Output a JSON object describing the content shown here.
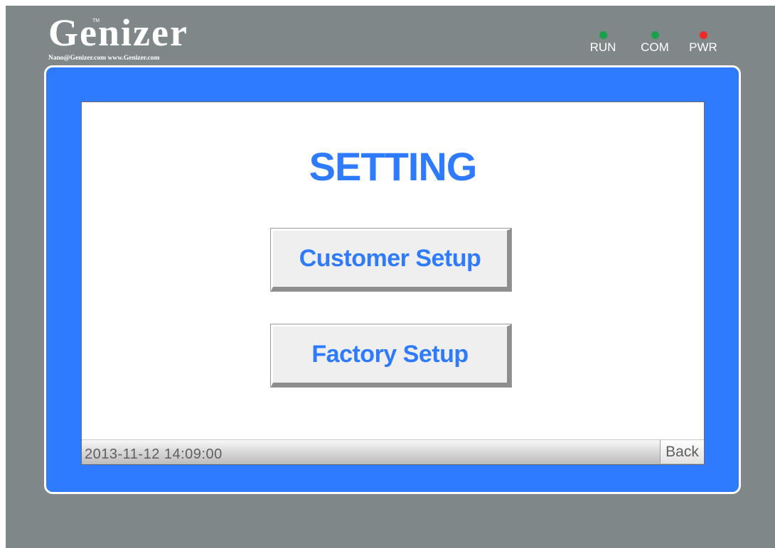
{
  "brand": {
    "name": "Genizer",
    "trademark": "TM",
    "contact": "Nano@Genizer.com  www.Genizer.com"
  },
  "indicators": [
    {
      "label": "RUN",
      "color": "#1aa04a"
    },
    {
      "label": "COM",
      "color": "#1aa04a"
    },
    {
      "label": "PWR",
      "color": "#ee2a2a"
    }
  ],
  "screen": {
    "title": "SETTING",
    "buttons": {
      "customer_setup": "Customer Setup",
      "factory_setup": "Factory Setup"
    },
    "statusbar": {
      "datetime": "2013-11-12 14:09:00",
      "back_label": "Back"
    }
  },
  "colors": {
    "accent": "#2e7bff",
    "bezel": "#7f8788"
  }
}
